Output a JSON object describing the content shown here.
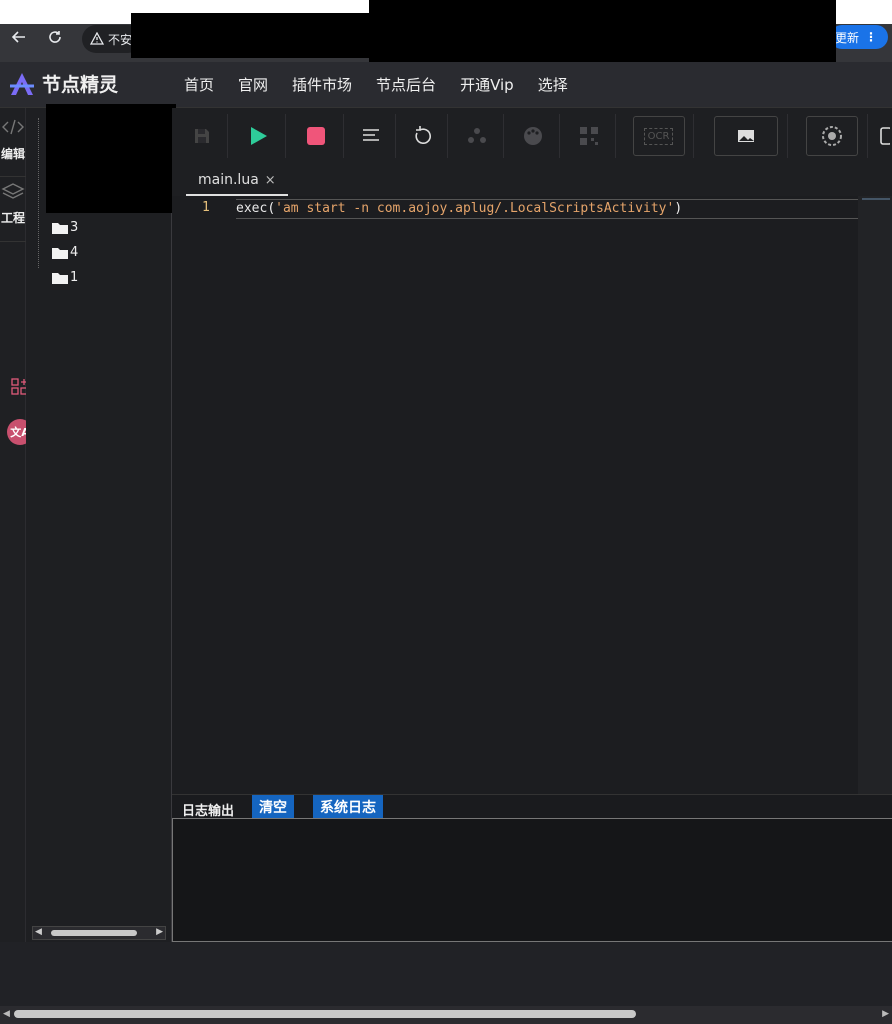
{
  "browser": {
    "back_icon": "arrow-left-icon",
    "reload_icon": "reload-icon",
    "insecure_label": "不安",
    "update_label": "更新"
  },
  "header": {
    "logo_text": "节点精灵",
    "menu": [
      {
        "label": "首页"
      },
      {
        "label": "官网"
      },
      {
        "label": "插件市场"
      },
      {
        "label": "节点后台"
      },
      {
        "label": "开通Vip"
      },
      {
        "label": "选择"
      }
    ]
  },
  "left_rail": {
    "edit_label": "编辑",
    "project_label": "工程"
  },
  "file_tree": {
    "folders": [
      {
        "name": "3"
      },
      {
        "name": "4"
      },
      {
        "name": "1"
      }
    ]
  },
  "toolbar": {
    "ocr_label": "OCR",
    "colors": {
      "run": "#2ecc9a",
      "stop": "#f0557a"
    }
  },
  "tabs": [
    {
      "label": "main.lua",
      "close": "×"
    }
  ],
  "editor": {
    "line_number": "1",
    "code_fn": "exec",
    "code_open": "(",
    "code_str": "'am start -n com.aojoy.aplug/.LocalScriptsActivity'",
    "code_close": ")"
  },
  "log": {
    "title": "日志输出",
    "clear_label": "清空",
    "system_log_label": "系统日志"
  }
}
